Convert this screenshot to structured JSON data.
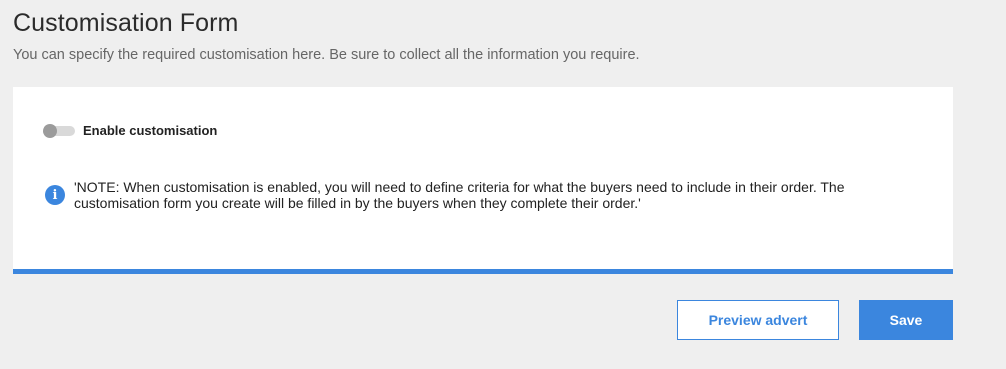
{
  "header": {
    "title": "Customisation Form",
    "subtitle": "You can specify the required customisation here. Be sure to collect all the information you require."
  },
  "card": {
    "toggle": {
      "label": "Enable customisation",
      "enabled": false
    },
    "note": {
      "icon": "info-icon",
      "icon_glyph": "i",
      "text": "'NOTE: When customisation is enabled, you will need to define criteria for what the buyers need to include in their order. The customisation form you create will be filled in by the buyers when they complete their order.'"
    }
  },
  "actions": {
    "preview_label": "Preview advert",
    "save_label": "Save"
  },
  "colors": {
    "accent": "#3b86de",
    "background": "#efefef",
    "card": "#ffffff"
  }
}
